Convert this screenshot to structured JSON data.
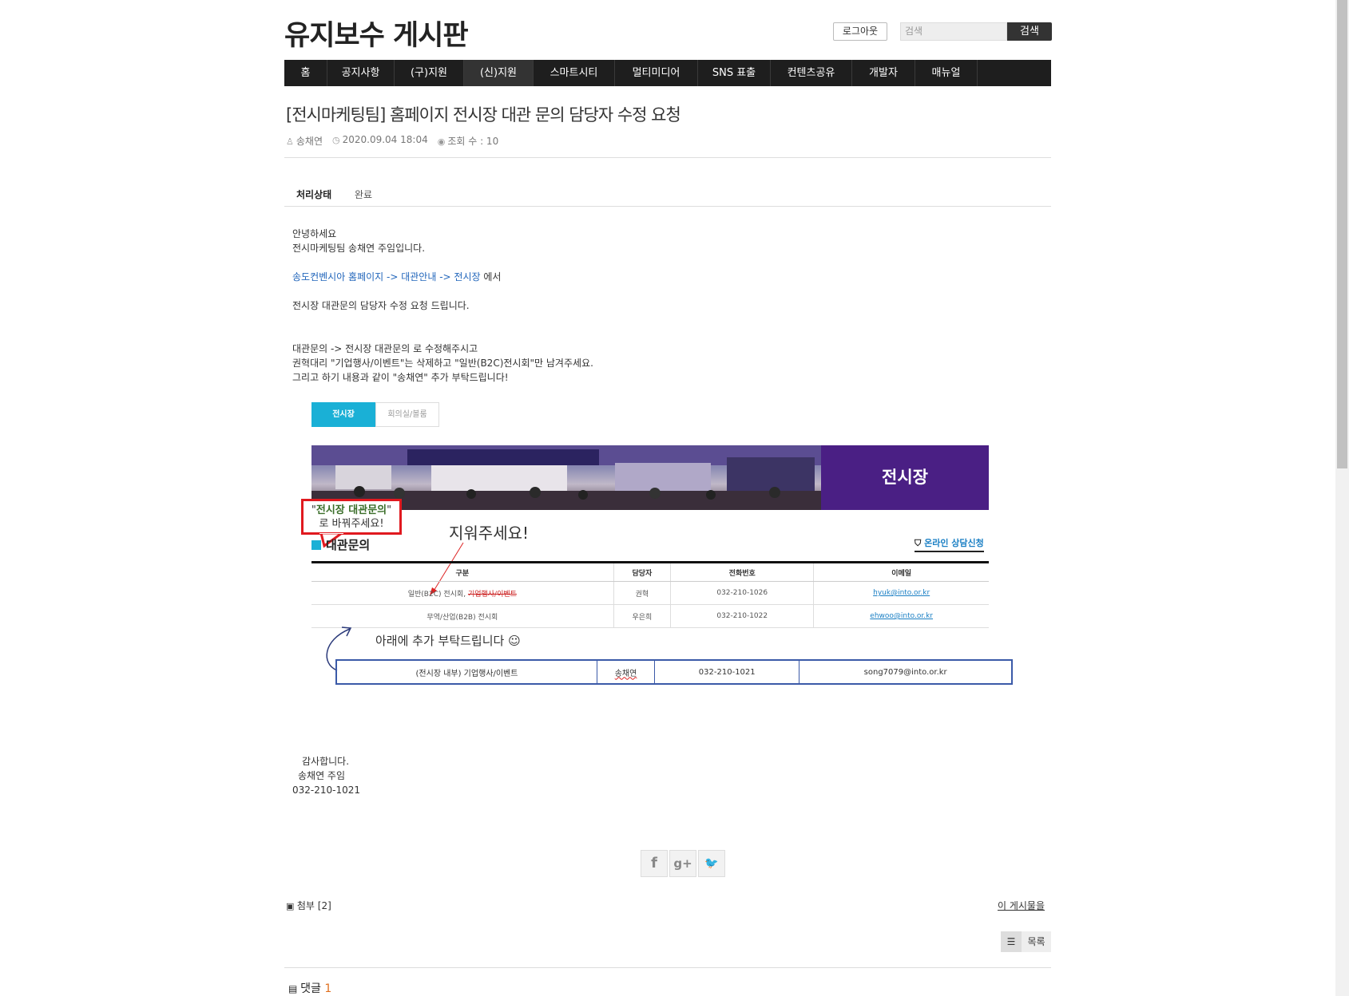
{
  "header": {
    "site_title": "유지보수 게시판",
    "logout_label": "로그아웃",
    "search_placeholder": "검색",
    "search_button": "검색"
  },
  "nav": {
    "items": [
      "홈",
      "공지사항",
      "(구)지원",
      "(신)지원",
      "스마트시티",
      "멀티미디어",
      "SNS 표출",
      "컨텐츠공유",
      "개발자",
      "매뉴얼"
    ],
    "active_index": 3
  },
  "post": {
    "title": "[전시마케팅팀] 홈페이지 전시장 대관 문의 담당자 수정 요청",
    "author": "송채연",
    "datetime": "2020.09.04 18:04",
    "views": "조회 수 : 10",
    "status_label": "처리상태",
    "status_value": "완료"
  },
  "body": {
    "greeting1": "안녕하세요",
    "greeting2": "전시마케팅팀 송채연 주임입니다.",
    "path_link": "송도컨벤시아 홈페이지 -> 대관안내 -> 전시장",
    "path_suffix": " 에서",
    "request": "전시장 대관문의 담당자 수정 요청 드립니다.",
    "detail1": "대관문의  -> 전시장 대관문의    로 수정해주시고",
    "detail2": "권혁대리 \"기업행사/이벤트\"는 삭제하고 \"일반(B2C)전시회\"만 남겨주세요.",
    "detail3": "그리고 하기 내용과 같이 \"송채연\" 추가 부탁드립니다!",
    "closing1": "감사합니다.",
    "closing2": "송채연 주임",
    "closing3": "032-210-1021"
  },
  "screenshot": {
    "tab_active": "전시장",
    "tab_inactive": "회의실/볼룸",
    "banner_title": "전시장",
    "annotation_line1_pre": "\"",
    "annotation_line1_hl": "전시장 대관문의",
    "annotation_line1_post": "\"",
    "annotation_line2": "로 바꿔주세요!",
    "remove_note": "지워주세요!",
    "section_title": "대관문의",
    "online_button": "온라인 상담신청",
    "table_headers": [
      "구분",
      "담당자",
      "전화번호",
      "이메일"
    ],
    "rows": [
      {
        "category": "일반(B2C) 전시회, ",
        "struck": "기업행사/이벤트",
        "manager": "권혁",
        "phone": "032-210-1026",
        "email": "hyuk@into.or.kr"
      },
      {
        "category": "무역/산업(B2B) 전시회",
        "struck": "",
        "manager": "우은희",
        "phone": "032-210-1022",
        "email": "ehwoo@into.or.kr"
      }
    ],
    "add_note": "아래에 추가 부탁드립니다 ☺",
    "added_row": {
      "category": "(전시장 내부) 기업행사/이벤트",
      "manager": "송채연",
      "phone": "032-210-1021",
      "email": "song7079@into.or.kr"
    }
  },
  "share": {
    "facebook": "f",
    "google": "g+",
    "twitter": "🐦"
  },
  "footer": {
    "attach_label": "첨부 [2]",
    "this_post_label": "이 게시물을",
    "list_button": "목록",
    "comment_label": "댓글",
    "comment_count": "1"
  }
}
